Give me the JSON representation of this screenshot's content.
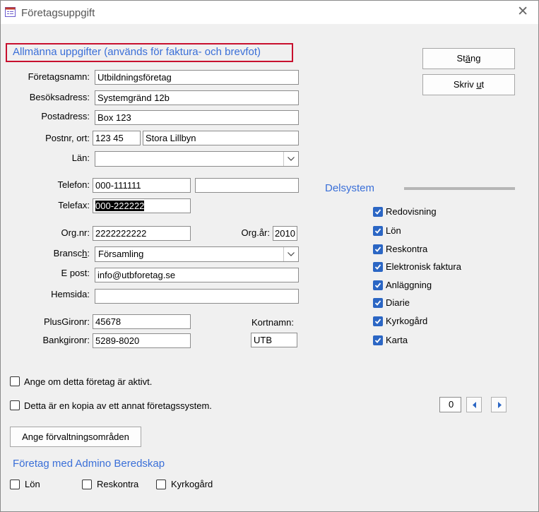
{
  "window": {
    "title": "Företagsuppgift",
    "close_symbol": "✕"
  },
  "section_general": {
    "title": "Allmänna uppgifter (används för faktura- och brevfot)"
  },
  "form": {
    "company_name_label": "Företagsnamn:",
    "company_name_value": "Utbildningsföretag",
    "visit_address_label": "Besöksadress:",
    "visit_address_value": "Systemgränd 12b",
    "postal_address_label": "Postadress:",
    "postal_address_value": "Box 123",
    "postal_code_city_label": "Postnr, ort:",
    "postal_code_value": "123 45",
    "city_value": "Stora Lillbyn",
    "county_label": "Län:",
    "county_value": "",
    "phone_label": "Telefon:",
    "phone_value": "000-111111",
    "phone2_value": "",
    "fax_label": "Telefax:",
    "fax_value": "000-222222",
    "org_nr_label": "Org.nr:",
    "org_nr_value": "2222222222",
    "org_year_label": "Org.år:",
    "org_year_value": "2010",
    "industry_label_pre": "Bransc",
    "industry_label_u": "h",
    "industry_label_post": ":",
    "industry_value": "Församling",
    "email_label": "E post:",
    "email_value": "info@utbforetag.se",
    "website_label": "Hemsida:",
    "website_value": "",
    "plusgiro_label": "PlusGironr:",
    "plusgiro_value": "45678",
    "bankgiro_label": "Bankgironr:",
    "bankgiro_value": "5289-8020",
    "shortname_label": "Kortnamn:",
    "shortname_value": "UTB"
  },
  "buttons": {
    "close_pre": "St",
    "close_u": "ä",
    "close_post": "ng",
    "print_pre": "Skriv ",
    "print_u": "u",
    "print_post": "t",
    "admin_areas": "Ange förvaltningsområden"
  },
  "subsystems": {
    "title": "Delsystem",
    "items": [
      {
        "label": "Redovisning",
        "checked": true
      },
      {
        "label": "Lön",
        "checked": true
      },
      {
        "label": "Reskontra",
        "checked": true
      },
      {
        "label": "Elektronisk faktura",
        "checked": true
      },
      {
        "label": "Anläggning",
        "checked": true
      },
      {
        "label": "Diarie",
        "checked": true
      },
      {
        "label": "Kyrkogård",
        "checked": true
      },
      {
        "label": "Karta",
        "checked": true
      }
    ]
  },
  "options": {
    "active_label": "Ange om detta företag är aktivt.",
    "active_checked": false,
    "copy_label": "Detta är en kopia av ett annat företagssystem.",
    "copy_checked": false
  },
  "record_nav": {
    "counter": "0"
  },
  "admino": {
    "title": "Företag med Admino Beredskap",
    "items": [
      {
        "label": "Lön",
        "checked": false
      },
      {
        "label": "Reskontra",
        "checked": false
      },
      {
        "label": "Kyrkogård",
        "checked": false
      }
    ]
  },
  "colors": {
    "accent": "#3a6fd8",
    "highlight_border": "#c8102e",
    "checkbox": "#2b66c4"
  }
}
